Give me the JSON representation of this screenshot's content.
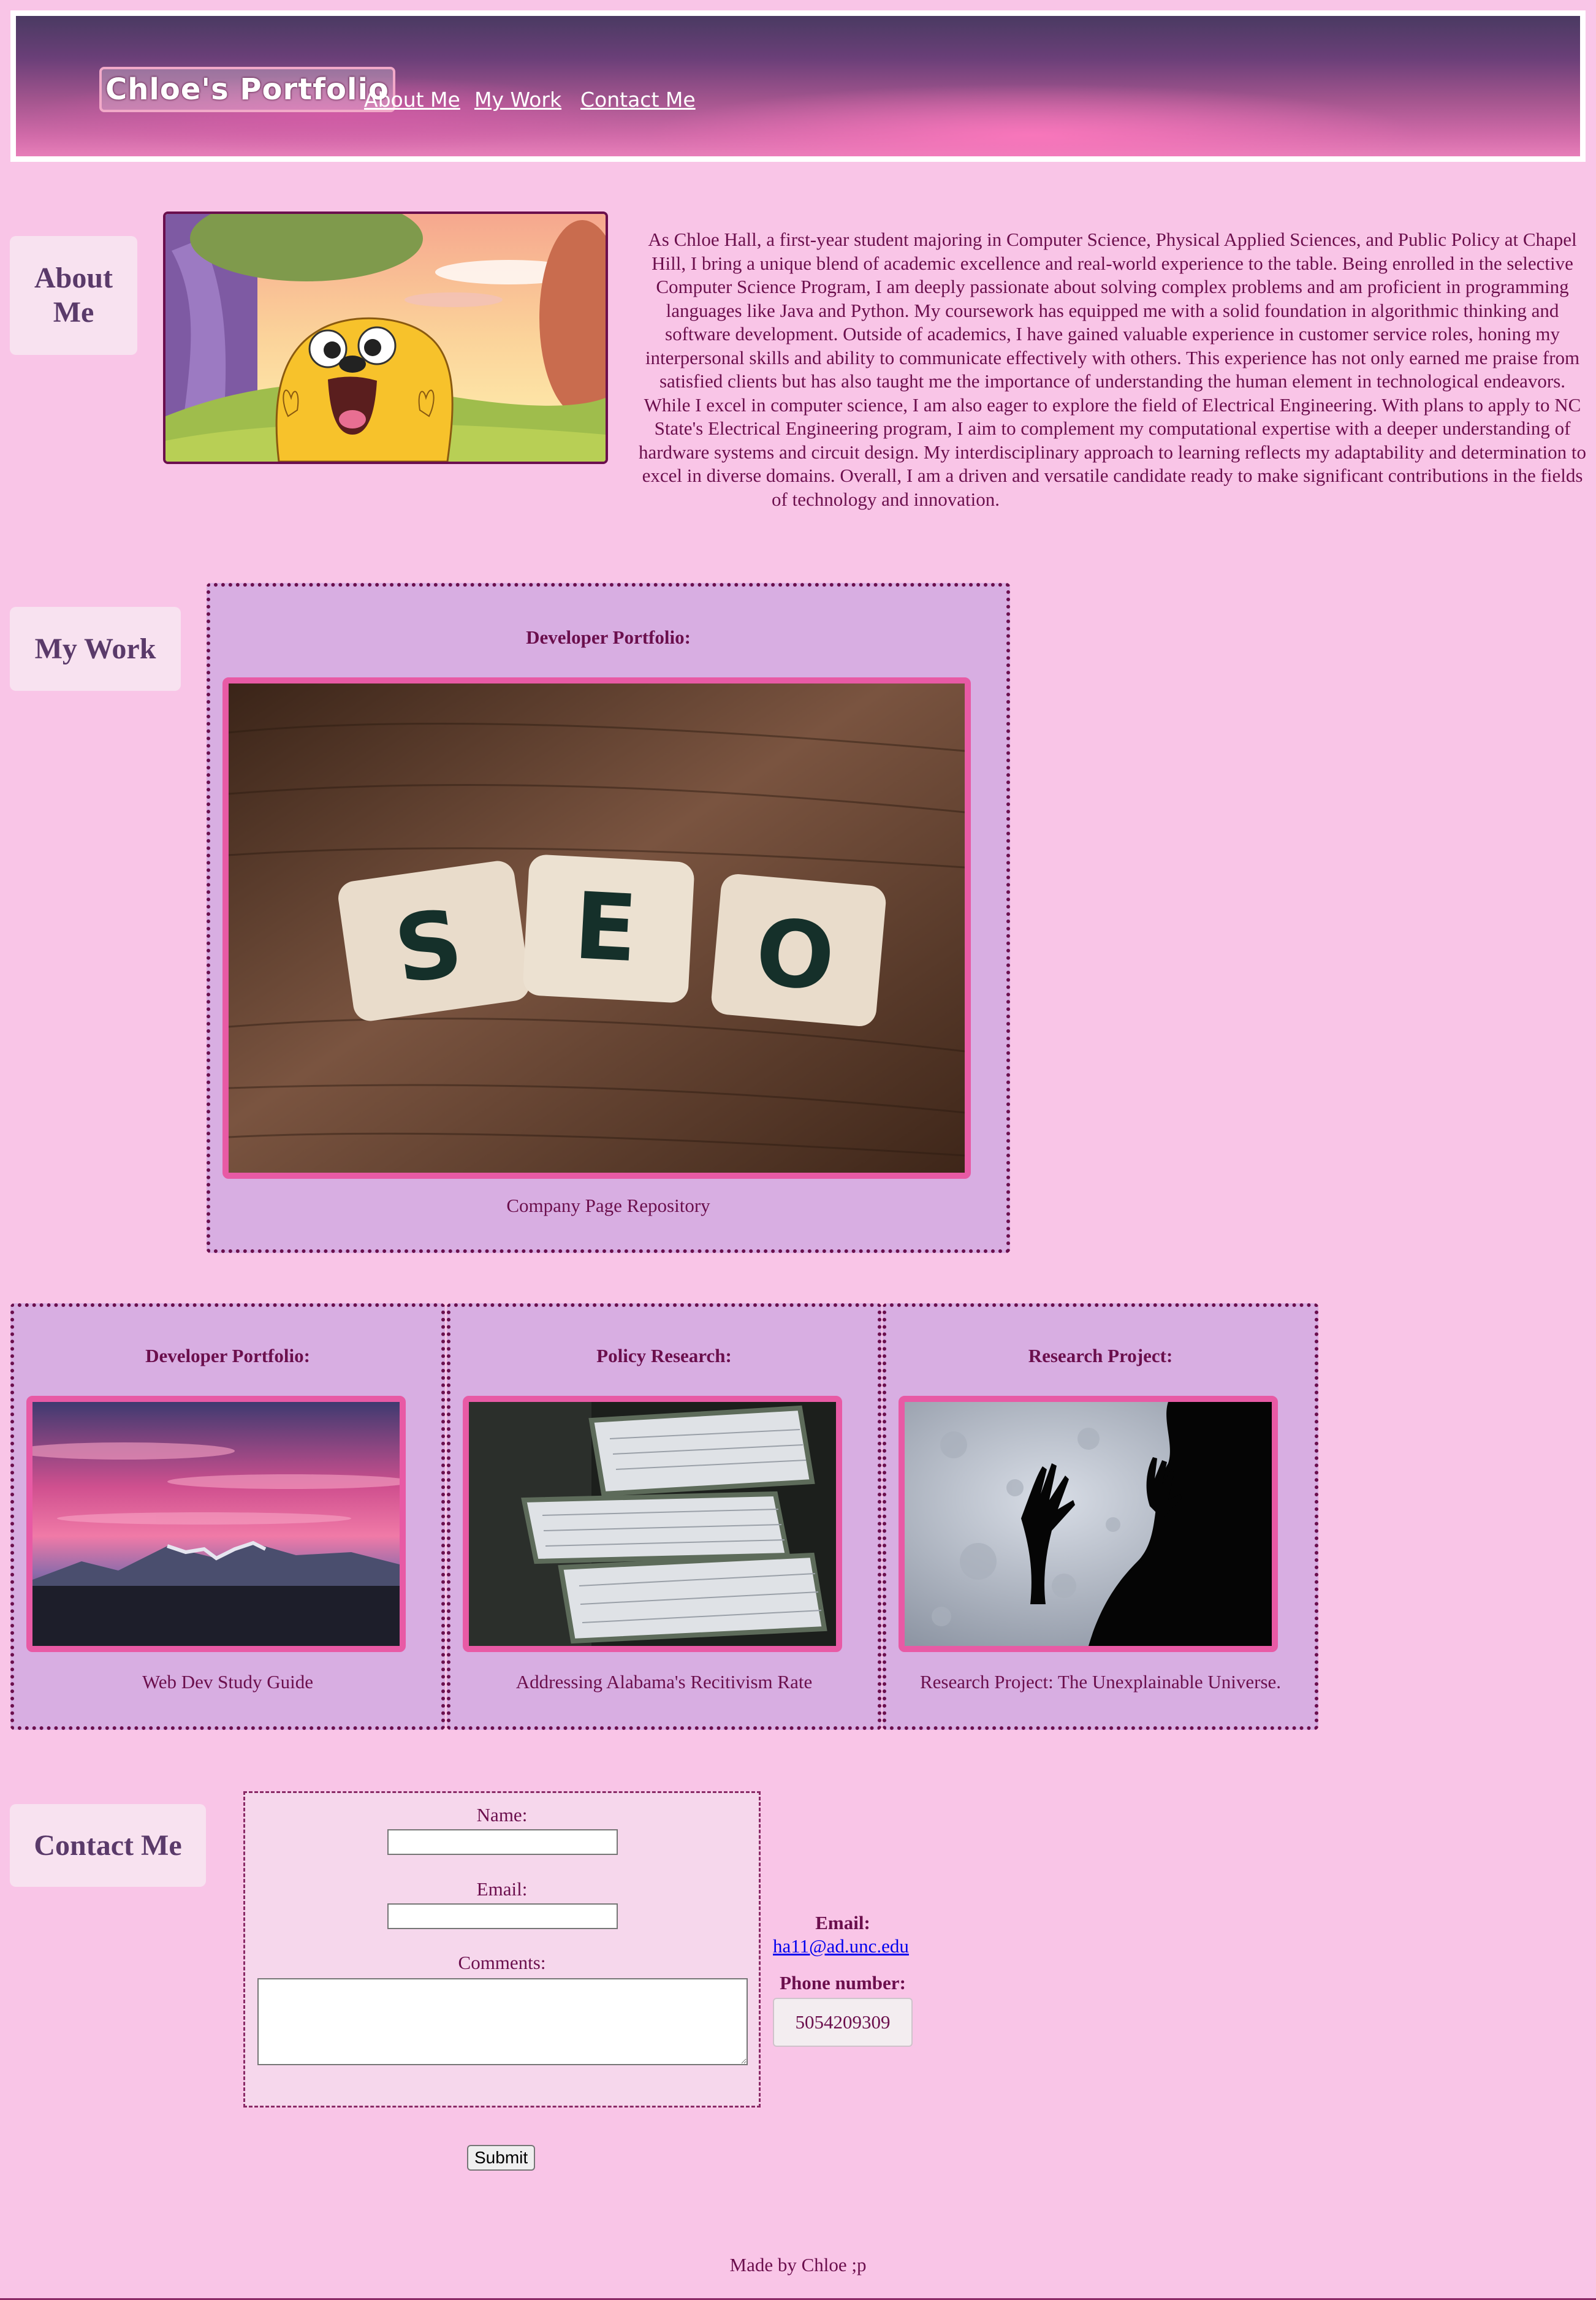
{
  "header": {
    "brand": "Chloe's Portfolio",
    "nav": [
      "About Me",
      "My Work",
      "Contact Me"
    ]
  },
  "about": {
    "heading": "About Me",
    "image_alt": "Jake the Dog cartoon",
    "text": "As Chloe Hall, a first-year student majoring in Computer Science, Physical Applied Sciences, and Public Policy at Chapel Hill, I bring a unique blend of academic excellence and real-world experience to the table. Being enrolled in the selective Computer Science Program, I am deeply passionate about solving complex problems and am proficient in programming languages like Java and Python. My coursework has equipped me with a solid foundation in algorithmic thinking and software development. Outside of academics, I have gained valuable experience in customer service roles, honing my interpersonal skills and ability to communicate effectively with others. This experience has not only earned me praise from satisfied clients but has also taught me the importance of understanding the human element in technological endeavors. While I excel in computer science, I am also eager to explore the field of Electrical Engineering. With plans to apply to NC State's Electrical Engineering program, I aim to complement my computational expertise with a deeper understanding of hardware systems and circuit design. My interdisciplinary approach to learning reflects my adaptability and determination to excel in diverse domains. Overall, I am a driven and versatile candidate ready to make significant contributions in the fields of technology and innovation."
  },
  "work": {
    "heading": "My Work",
    "featured": {
      "title": "Developer Portfolio:",
      "caption": "Company Page Repository",
      "tiles": [
        "S",
        "E",
        "O"
      ]
    },
    "cards": [
      {
        "title": "Developer Portfolio:",
        "caption": "Web Dev Study Guide"
      },
      {
        "title": "Policy Research:",
        "caption": "Addressing Alabama's Recitivism Rate"
      },
      {
        "title": "Research Project:",
        "caption": "Research Project: The Unexplainable Universe."
      }
    ]
  },
  "contact": {
    "heading": "Contact Me",
    "form": {
      "name_label": "Name:",
      "name_value": "",
      "email_label": "Email:",
      "email_value": "",
      "comments_label": "Comments:",
      "comments_value": "",
      "submit_label": "Submit"
    },
    "email_label": "Email:",
    "email": "ha11@ad.unc.edu",
    "phone_label": "Phone number:",
    "phone": "5054209309"
  },
  "footer": {
    "text": "Made by Chloe ;p"
  },
  "colors": {
    "background": "#f9c5e7",
    "text": "#6b0f4d",
    "card": "#d8aee2",
    "image_border": "#e85aa5"
  }
}
